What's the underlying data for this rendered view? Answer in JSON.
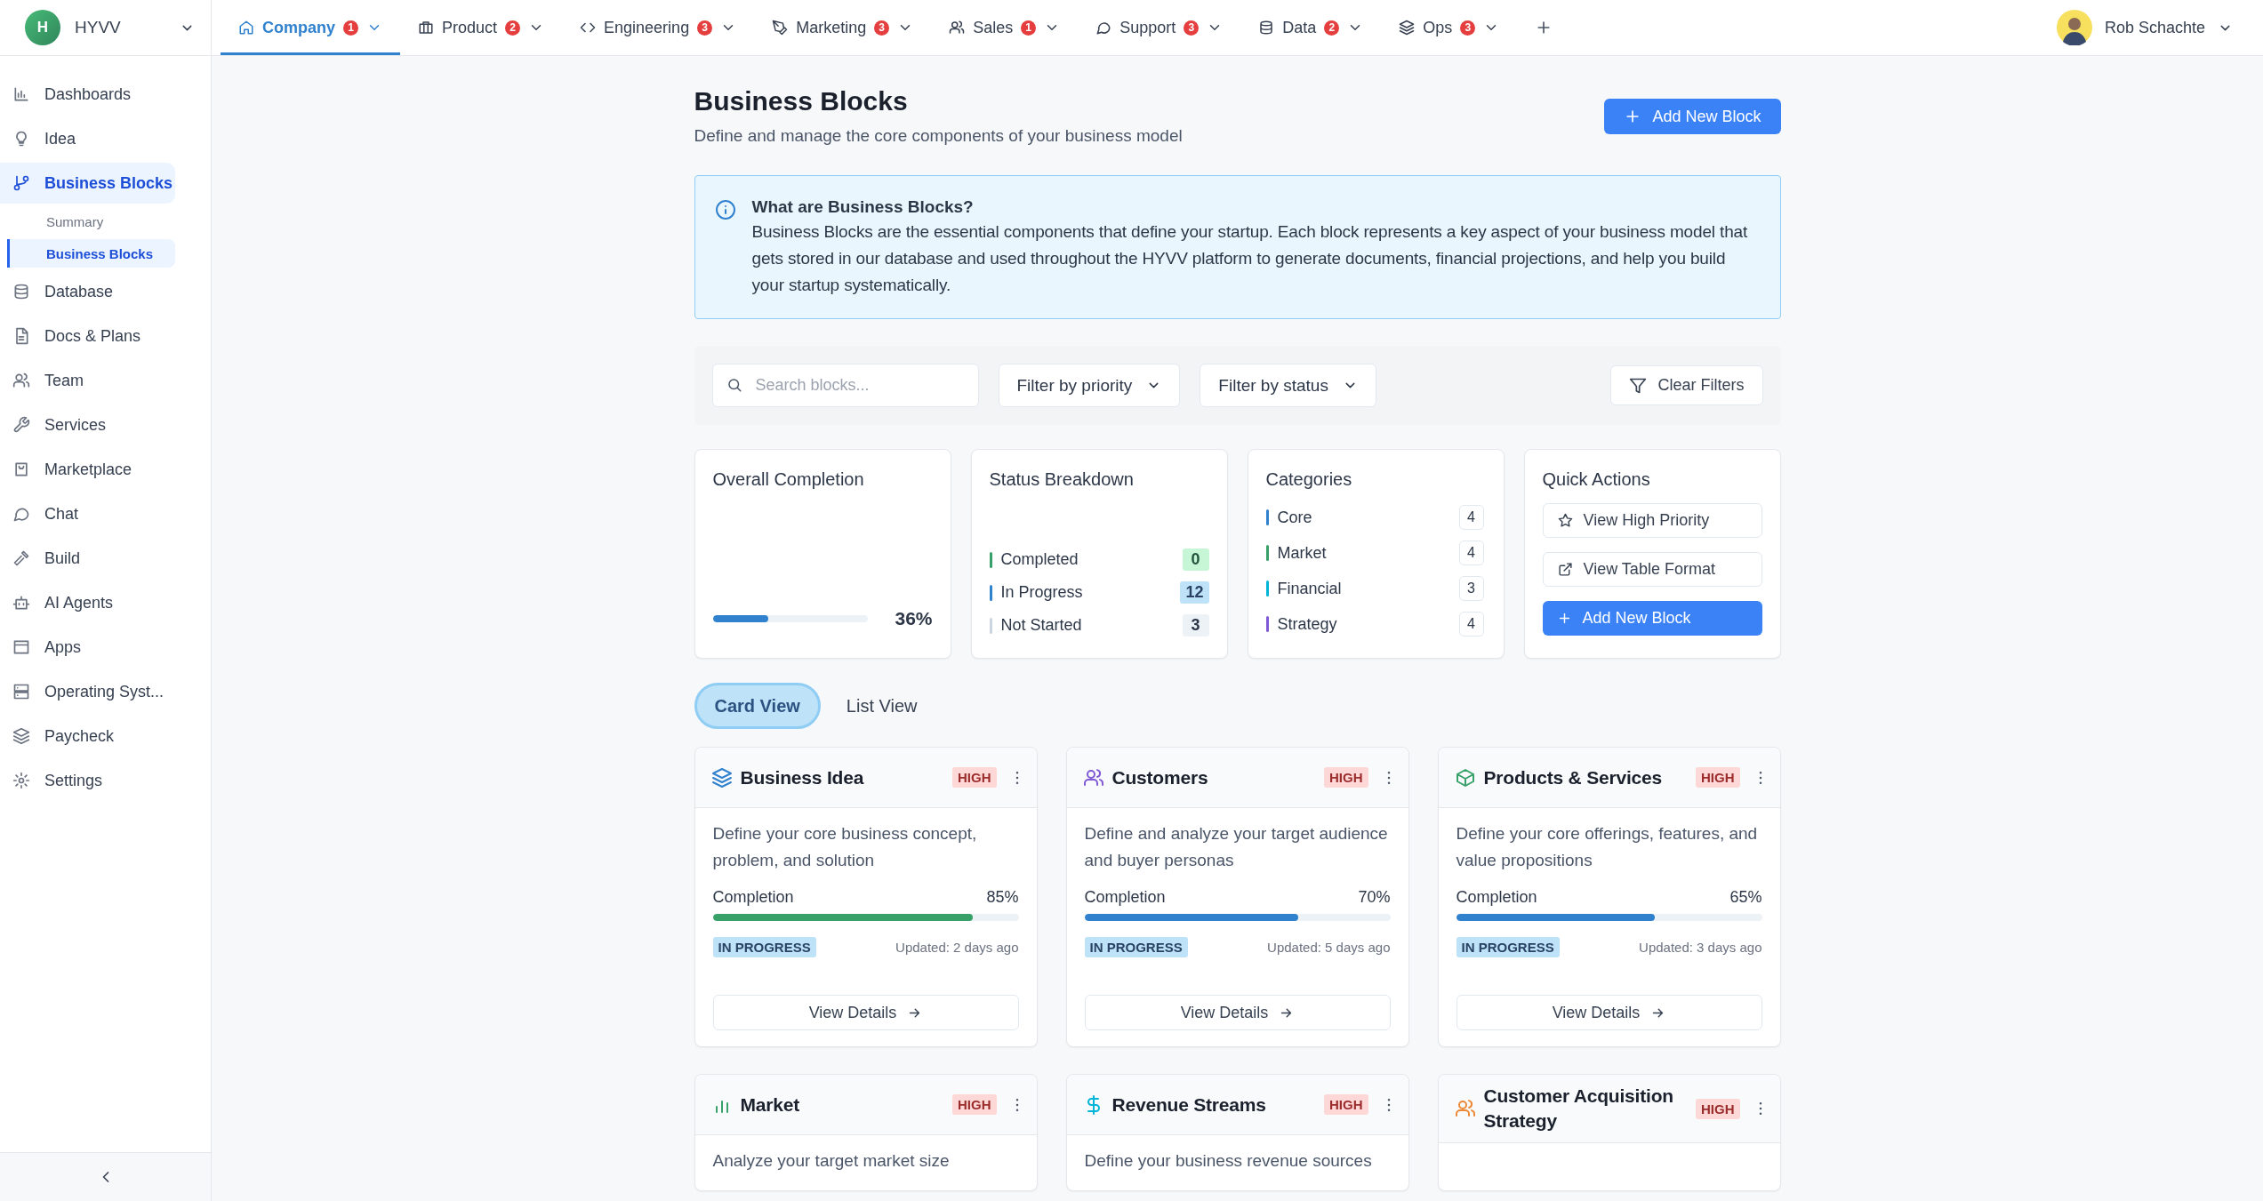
{
  "brand": {
    "initial": "H",
    "name": "HYVV"
  },
  "nav_tabs": [
    {
      "label": "Company",
      "badge": "1",
      "selected": true
    },
    {
      "label": "Product",
      "badge": "2",
      "selected": false
    },
    {
      "label": "Engineering",
      "badge": "3",
      "selected": false
    },
    {
      "label": "Marketing",
      "badge": "3",
      "selected": false
    },
    {
      "label": "Sales",
      "badge": "1",
      "selected": false
    },
    {
      "label": "Support",
      "badge": "3",
      "selected": false
    },
    {
      "label": "Data",
      "badge": "2",
      "selected": false
    },
    {
      "label": "Ops",
      "badge": "3",
      "selected": false
    }
  ],
  "user": {
    "name": "Rob Schachte"
  },
  "sidebar": {
    "items": [
      {
        "label": "Dashboards",
        "selected": false
      },
      {
        "label": "Idea",
        "selected": false
      },
      {
        "label": "Business Blocks",
        "selected": true,
        "children": [
          {
            "label": "Summary",
            "selected": false
          },
          {
            "label": "Business Blocks",
            "selected": true
          }
        ]
      },
      {
        "label": "Database",
        "selected": false
      },
      {
        "label": "Docs & Plans",
        "selected": false
      },
      {
        "label": "Team",
        "selected": false
      },
      {
        "label": "Services",
        "selected": false
      },
      {
        "label": "Marketplace",
        "selected": false
      },
      {
        "label": "Chat",
        "selected": false
      },
      {
        "label": "Build",
        "selected": false
      },
      {
        "label": "AI Agents",
        "selected": false
      },
      {
        "label": "Apps",
        "selected": false
      },
      {
        "label": "Operating Syst...",
        "selected": false
      },
      {
        "label": "Paycheck",
        "selected": false
      },
      {
        "label": "Settings",
        "selected": false
      }
    ]
  },
  "page": {
    "title": "Business Blocks",
    "subtitle": "Define and manage the core components of your business model",
    "add_button": "Add New Block"
  },
  "info": {
    "title": "What are Business Blocks?",
    "text": "Business Blocks are the essential components that define your startup. Each block represents a key aspect of your business model that gets stored in our database and used throughout the HYVV platform to generate documents, financial projections, and help you build your startup systematically."
  },
  "filters": {
    "search_placeholder": "Search blocks...",
    "selects": [
      "Filter by priority",
      "Filter by status"
    ],
    "clear": "Clear Filters"
  },
  "stats": {
    "completion": {
      "title": "Overall Completion",
      "level": 0.36,
      "reading": "36%"
    },
    "status": {
      "title": "Status Breakdown",
      "items": [
        {
          "label": "Completed",
          "count": "0",
          "color": "#38a169"
        },
        {
          "label": "In Progress",
          "count": "12",
          "color": "#3182ce"
        },
        {
          "label": "Not Started",
          "count": "3",
          "color": "#cbd5e0"
        }
      ]
    },
    "categories": {
      "title": "Categories",
      "items": [
        {
          "label": "Core",
          "count": "4",
          "color": "#3182ce"
        },
        {
          "label": "Market",
          "count": "4",
          "color": "#38a169"
        },
        {
          "label": "Financial",
          "count": "3",
          "color": "#00b5d8"
        },
        {
          "label": "Strategy",
          "count": "4",
          "color": "#805ad5"
        }
      ]
    },
    "quick_actions": {
      "title": "Quick Actions",
      "actions": [
        {
          "label": "View High Priority",
          "kind": "outline"
        },
        {
          "label": "View Table Format",
          "kind": "outline"
        },
        {
          "label": "Add New Block",
          "kind": "primary"
        }
      ]
    }
  },
  "view_toggle": [
    {
      "label": "Card View",
      "selected": true
    },
    {
      "label": "List View",
      "selected": false
    }
  ],
  "blocks": [
    {
      "title": "Business Idea",
      "priority": "HIGH",
      "description": "Define your core business concept, problem, and solution",
      "completion_label": "Completion",
      "level": 0.85,
      "reading": "85%",
      "color": "#38a169",
      "status": "IN PROGRESS",
      "updated": "Updated: 2 days ago",
      "action": "View Details"
    },
    {
      "title": "Customers",
      "priority": "HIGH",
      "description": "Define and analyze your target audience and buyer personas",
      "completion_label": "Completion",
      "level": 0.7,
      "reading": "70%",
      "color": "#3182ce",
      "status": "IN PROGRESS",
      "updated": "Updated: 5 days ago",
      "action": "View Details"
    },
    {
      "title": "Products & Services",
      "priority": "HIGH",
      "description": "Define your core offerings, features, and value propositions",
      "completion_label": "Completion",
      "level": 0.65,
      "reading": "65%",
      "color": "#3182ce",
      "status": "IN PROGRESS",
      "updated": "Updated: 3 days ago",
      "action": "View Details"
    },
    {
      "title": "Market",
      "priority": "HIGH",
      "description": "Analyze your target market size"
    },
    {
      "title": "Revenue Streams",
      "priority": "HIGH",
      "description": "Define your business revenue sources"
    },
    {
      "title": "Customer Acquisition Strategy",
      "priority": "HIGH"
    }
  ]
}
